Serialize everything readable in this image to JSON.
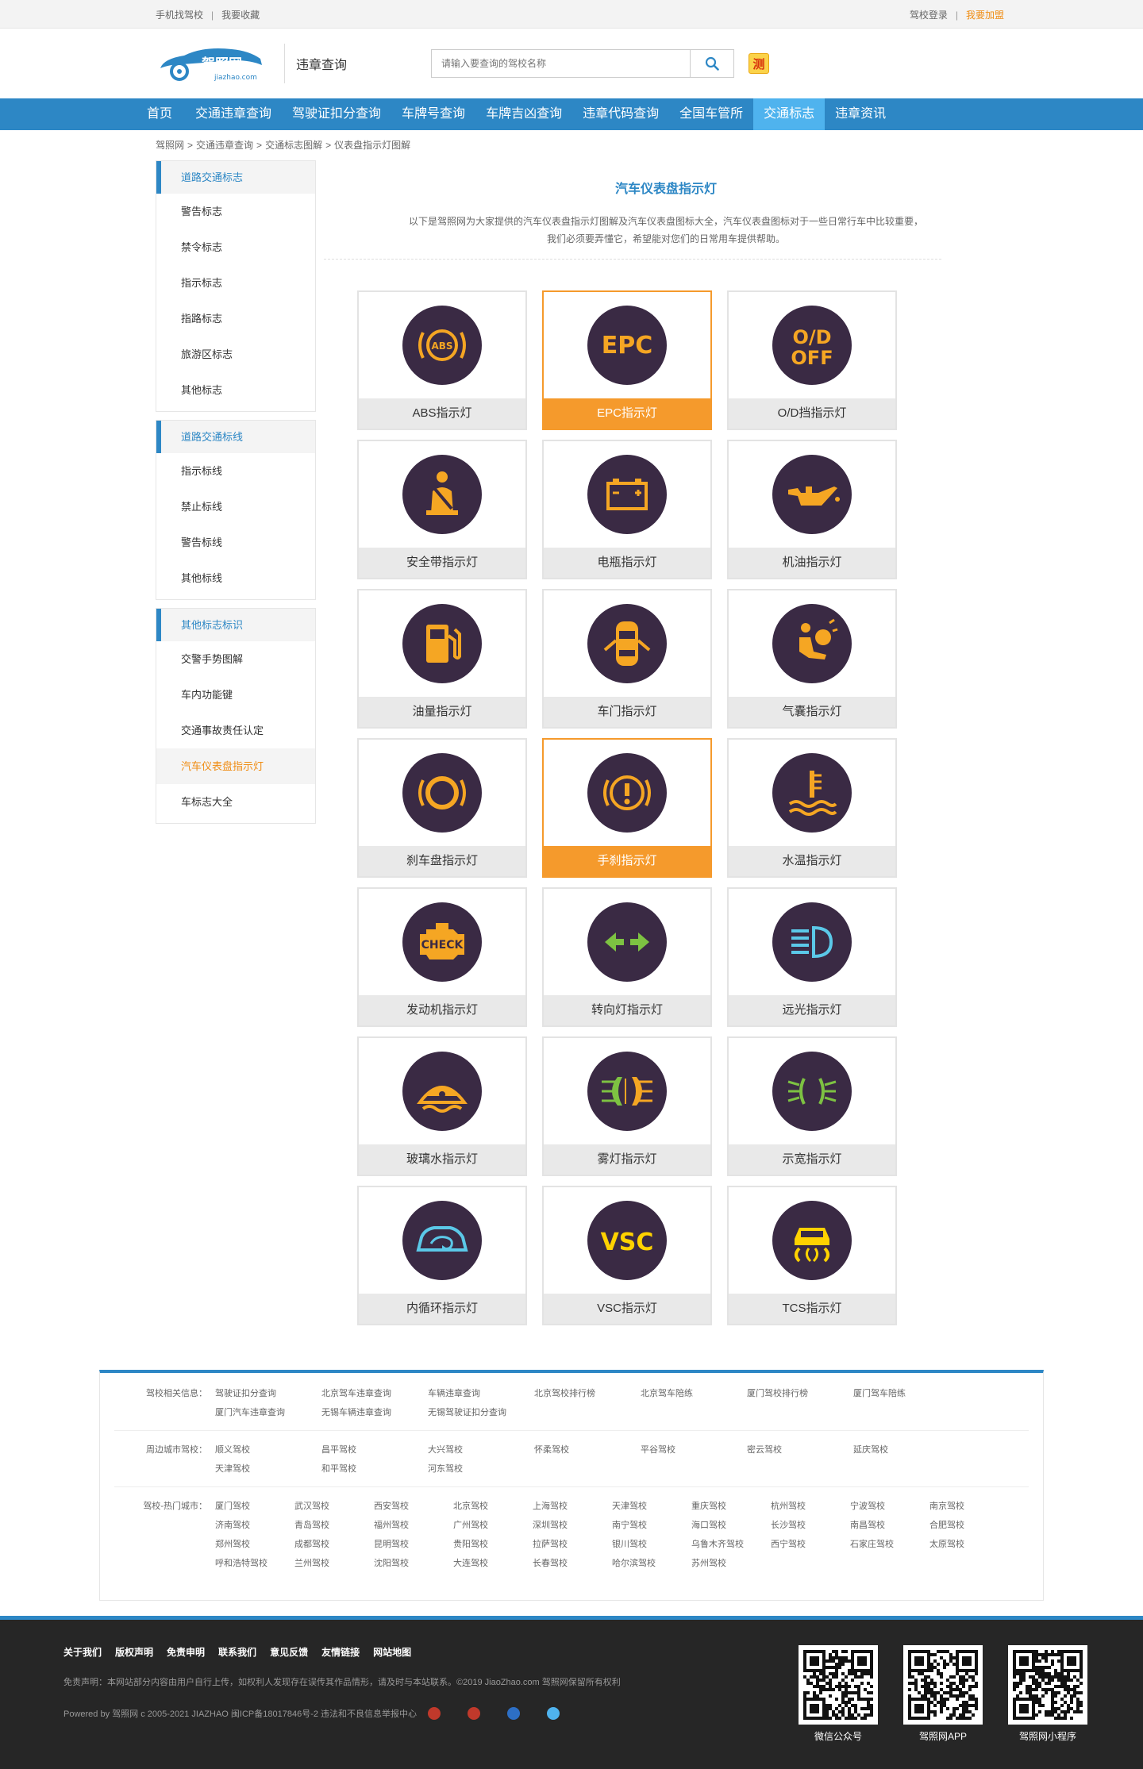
{
  "topbar": {
    "left": [
      "手机找驾校",
      "我要收藏"
    ],
    "right_login": "驾校登录",
    "right_join": "我要加盟"
  },
  "header": {
    "logo_text": "驾照网",
    "logo_sub": "jiazhao.com",
    "sub_title": "违章查询",
    "search_placeholder": "请输入要查询的驾校名称",
    "badge": "测"
  },
  "nav": [
    {
      "label": "首页",
      "active": false
    },
    {
      "label": "交通违章查询",
      "active": false
    },
    {
      "label": "驾驶证扣分查询",
      "active": false
    },
    {
      "label": "车牌号查询",
      "active": false
    },
    {
      "label": "车牌吉凶查询",
      "active": false
    },
    {
      "label": "违章代码查询",
      "active": false
    },
    {
      "label": "全国车管所",
      "active": false
    },
    {
      "label": "交通标志",
      "active": true
    },
    {
      "label": "违章资讯",
      "active": false
    }
  ],
  "breadcrumb": [
    "驾照网",
    "交通违章查询",
    "交通标志图解",
    "仪表盘指示灯图解"
  ],
  "sidebar": [
    {
      "title": "道路交通标志",
      "items": [
        "警告标志",
        "禁令标志",
        "指示标志",
        "指路标志",
        "旅游区标志",
        "其他标志"
      ]
    },
    {
      "title": "道路交通标线",
      "items": [
        "指示标线",
        "禁止标线",
        "警告标线",
        "其他标线"
      ]
    },
    {
      "title": "其他标志标识",
      "items": [
        "交警手势图解",
        "车内功能键",
        "交通事故责任认定",
        "汽车仪表盘指示灯",
        "车标志大全"
      ]
    }
  ],
  "sidebar_active": "汽车仪表盘指示灯",
  "content": {
    "title": "汽车仪表盘指示灯",
    "desc1": "以下是驾照网为大家提供的汽车仪表盘指示灯图解及汽车仪表盘图标大全，汽车仪表盘图标对于一些日常行车中比较重要，",
    "desc2": "我们必须要弄懂它，希望能对您们的日常用车提供帮助。"
  },
  "cards": [
    {
      "label": "ABS指示灯",
      "icon": "abs-icon",
      "highlight": false
    },
    {
      "label": "EPC指示灯",
      "icon": "epc-icon",
      "highlight": true
    },
    {
      "label": "O/D挡指示灯",
      "icon": "od-off-icon",
      "highlight": false
    },
    {
      "label": "安全带指示灯",
      "icon": "seatbelt-icon",
      "highlight": false
    },
    {
      "label": "电瓶指示灯",
      "icon": "battery-icon",
      "highlight": false
    },
    {
      "label": "机油指示灯",
      "icon": "oil-can-icon",
      "highlight": false
    },
    {
      "label": "油量指示灯",
      "icon": "fuel-pump-icon",
      "highlight": false
    },
    {
      "label": "车门指示灯",
      "icon": "car-door-icon",
      "highlight": false
    },
    {
      "label": "气囊指示灯",
      "icon": "airbag-icon",
      "highlight": false
    },
    {
      "label": "刹车盘指示灯",
      "icon": "brake-disc-icon",
      "highlight": false
    },
    {
      "label": "手刹指示灯",
      "icon": "handbrake-icon",
      "highlight": true
    },
    {
      "label": "水温指示灯",
      "icon": "coolant-temp-icon",
      "highlight": false
    },
    {
      "label": "发动机指示灯",
      "icon": "engine-check-icon",
      "highlight": false
    },
    {
      "label": "转向灯指示灯",
      "icon": "turn-signal-icon",
      "highlight": false
    },
    {
      "label": "远光指示灯",
      "icon": "high-beam-icon",
      "highlight": false
    },
    {
      "label": "玻璃水指示灯",
      "icon": "washer-fluid-icon",
      "highlight": false
    },
    {
      "label": "雾灯指示灯",
      "icon": "fog-light-icon",
      "highlight": false
    },
    {
      "label": "示宽指示灯",
      "icon": "width-light-icon",
      "highlight": false
    },
    {
      "label": "内循环指示灯",
      "icon": "recirculation-icon",
      "highlight": false
    },
    {
      "label": "VSC指示灯",
      "icon": "vsc-icon",
      "highlight": false
    },
    {
      "label": "TCS指示灯",
      "icon": "tcs-icon",
      "highlight": false
    }
  ],
  "footer_links": [
    {
      "label": "驾校相关信息：",
      "items": [
        "驾驶证扣分查询",
        "北京驾车违章查询",
        "车辆违章查询",
        "北京驾校排行榜",
        "北京驾车陪练",
        "厦门驾校排行榜",
        "厦门驾车陪练",
        "厦门汽车违章查询",
        "无锡车辆违章查询",
        "无锡驾驶证扣分查询"
      ]
    },
    {
      "label": "周边城市驾校：",
      "items": [
        "顺义驾校",
        "昌平驾校",
        "大兴驾校",
        "怀柔驾校",
        "平谷驾校",
        "密云驾校",
        "延庆驾校",
        "天津驾校",
        "和平驾校",
        "河东驾校"
      ]
    },
    {
      "label": "驾校-热门城市：",
      "items": [
        "厦门驾校",
        "武汉驾校",
        "西安驾校",
        "北京驾校",
        "上海驾校",
        "天津驾校",
        "重庆驾校",
        "杭州驾校",
        "宁波驾校",
        "南京驾校",
        "济南驾校",
        "青岛驾校",
        "福州驾校",
        "广州驾校",
        "深圳驾校",
        "南宁驾校",
        "海口驾校",
        "长沙驾校",
        "南昌驾校",
        "合肥驾校",
        "郑州驾校",
        "成都驾校",
        "昆明驾校",
        "贵阳驾校",
        "拉萨驾校",
        "银川驾校",
        "乌鲁木齐驾校",
        "西宁驾校",
        "石家庄驾校",
        "太原驾校",
        "呼和浩特驾校",
        "兰州驾校",
        "沈阳驾校",
        "大连驾校",
        "长春驾校",
        "哈尔滨驾校",
        "苏州驾校"
      ]
    }
  ],
  "footer": {
    "nav": [
      "关于我们",
      "版权声明",
      "免责申明",
      "联系我们",
      "意见反馈",
      "友情链接",
      "网站地图"
    ],
    "disclaimer": "免责声明：本网站部分内容由用户自行上传，如权利人发现存在误传其作品情形，请及时与本站联系。©2019 JiaoZhao.com 驾照网保留所有权利",
    "copyright": "Powered by 驾照网 c 2005-2021 JIAZHAO 闽ICP备18017846号-2    违法和不良信息举报中心",
    "qrcodes": [
      "微信公众号",
      "驾照网APP",
      "驾照网小程序"
    ]
  },
  "colors": {
    "brand_blue": "#2d87c5",
    "nav_active": "#4fb3ee",
    "accent_orange": "#f59a2c",
    "icon_amber": "#f5a623",
    "icon_bg": "#3a2a44",
    "icon_green": "#7dc242",
    "icon_cyan": "#5bc8e8",
    "icon_yellow": "#ffd200"
  }
}
